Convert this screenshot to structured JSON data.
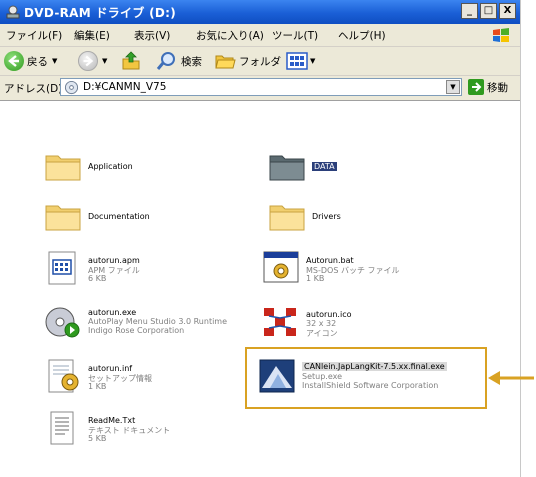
{
  "window": {
    "title": "DVD-RAM ドライブ (D:)",
    "controls": {
      "minimize": "_",
      "maximize": "□",
      "close": "X"
    }
  },
  "menubar": {
    "items": [
      "ファイル(F)",
      "編集(E)",
      "表示(V)",
      "お気に入り(A)",
      "ツール(T)",
      "ヘルプ(H)"
    ]
  },
  "toolbar": {
    "back_label": "戻る",
    "search_label": "検索",
    "folders_label": "フォルダ"
  },
  "addressbar": {
    "label": "アドレス(D)",
    "value": "D:¥CANMN_V75",
    "go_label": "移動"
  },
  "files": [
    {
      "name": "Application",
      "type": "",
      "detail": "",
      "icon": "folder-icon"
    },
    {
      "name": "DATA",
      "type": "",
      "detail": "",
      "icon": "folder-dark-icon"
    },
    {
      "name": "Documentation",
      "type": "",
      "detail": "",
      "icon": "folder-icon"
    },
    {
      "name": "Drivers",
      "type": "",
      "detail": "",
      "icon": "folder-icon"
    },
    {
      "name": "autorun.apm",
      "type": "APM ファイル",
      "detail": "6 KB",
      "icon": "apm-file-icon"
    },
    {
      "name": "Autorun.bat",
      "type": "MS-DOS バッチ ファイル",
      "detail": "1 KB",
      "icon": "batch-file-icon"
    },
    {
      "name": "autorun.exe",
      "type": "AutoPlay Menu Studio 3.0 Runtime",
      "detail": "Indigo Rose Corporation",
      "icon": "autoplay-exe-icon"
    },
    {
      "name": "autorun.ico",
      "type": "32 x 32",
      "detail": "アイコン",
      "icon": "ico-file-icon"
    },
    {
      "name": "autorun.inf",
      "type": "セットアップ情報",
      "detail": "1 KB",
      "icon": "inf-file-icon"
    },
    {
      "name": "CANlein.JapLangKit-7.5.xx.final.exe",
      "type": "Setup.exe",
      "detail": "InstallShield Software Corporation",
      "icon": "installer-exe-icon"
    },
    {
      "name": "ReadMe.Txt",
      "type": "テキスト ドキュメント",
      "detail": "5 KB",
      "icon": "text-file-icon"
    }
  ],
  "colors": {
    "titlebar": "#1a5fd6",
    "highlight_border": "#d9a223",
    "arrow": "#d9a223"
  }
}
